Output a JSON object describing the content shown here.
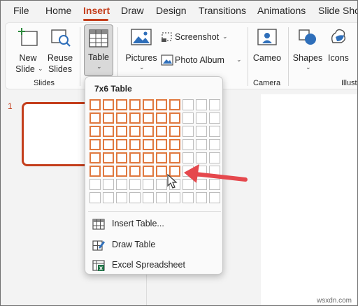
{
  "tabs": [
    "File",
    "Home",
    "Insert",
    "Draw",
    "Design",
    "Transitions",
    "Animations",
    "Slide Show"
  ],
  "active_tab": "Insert",
  "accent_color": "#c43e1c",
  "selection_color": "#e0783e",
  "arrow_color": "#e5484d",
  "ribbon": {
    "slides_group": {
      "label": "Slides",
      "new_slide": {
        "line1": "New",
        "line2": "Slide",
        "icon": "new-slide-icon"
      },
      "reuse_slides": {
        "line1": "Reuse",
        "line2": "Slides",
        "icon": "reuse-slides-icon"
      }
    },
    "table_group": {
      "table_label": "Table",
      "icon": "table-icon"
    },
    "images_group": {
      "pictures_label": "Pictures",
      "screenshot_label": "Screenshot",
      "photo_album_label": "Photo Album"
    },
    "camera_group": {
      "label": "Camera",
      "cameo_label": "Cameo"
    },
    "illustrations_group": {
      "label": "Illustr",
      "shapes_label": "Shapes",
      "icons_label": "Icons"
    }
  },
  "slide_panel": {
    "slide_number": "1"
  },
  "insert_table_dropdown": {
    "grid_title": "7x6 Table",
    "grid_columns": 10,
    "grid_rows": 8,
    "selected_columns": 7,
    "selected_rows": 6,
    "menu_items": [
      {
        "label": "Insert Table...",
        "icon": "insert-table-icon"
      },
      {
        "label": "Draw Table",
        "icon": "draw-table-icon"
      },
      {
        "label": "Excel Spreadsheet",
        "icon": "excel-spreadsheet-icon"
      }
    ]
  },
  "watermark": "wsxdn.com"
}
